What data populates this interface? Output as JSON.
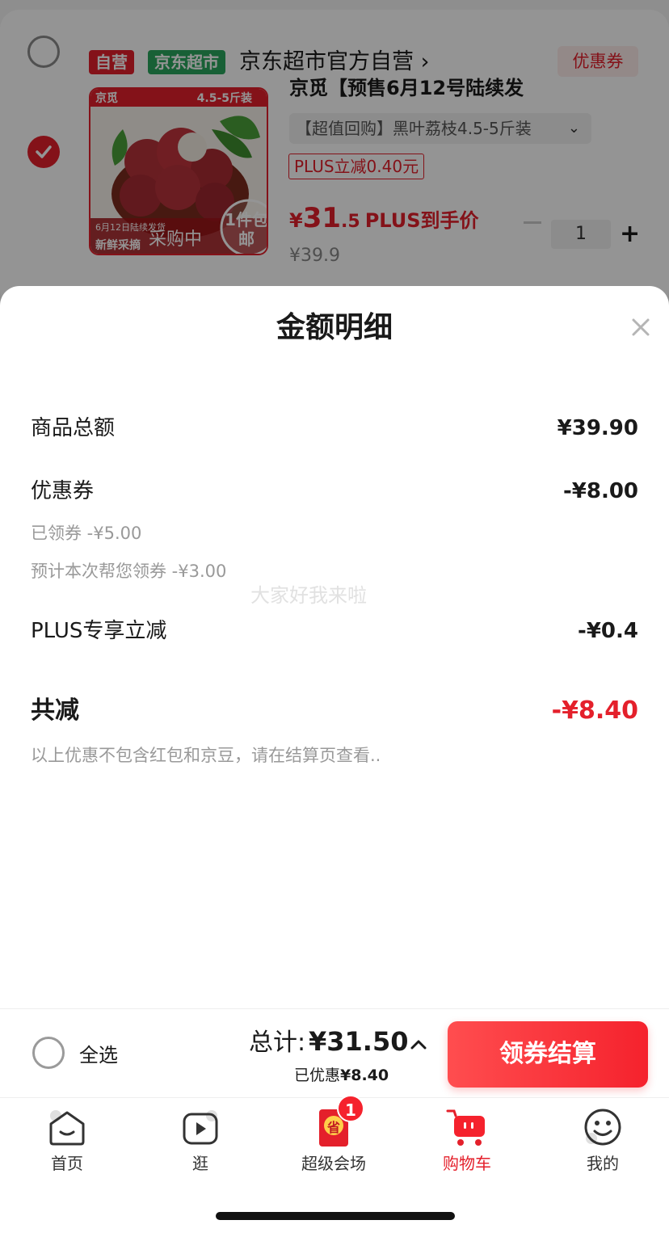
{
  "cart": {
    "shop_tag_self": "自营",
    "shop_tag_market": "京东超市",
    "shop_name": "京东超市官方自营 ›",
    "coupon_label": "优惠券",
    "product": {
      "title": "京觅【预售6月12号陆续发",
      "image_tag": "4.5-5斤装",
      "image_logo": "京觅",
      "image_badge_date": "6月12日陆续发货",
      "image_caption": "新鲜采摘",
      "image_overlay": "采购中",
      "image_free_ship": "1件包邮",
      "spec": "【超值回购】黑叶荔枝4.5-5斤装",
      "spec_chevron": "⌄",
      "plus_discount": "PLUS立减0.40元",
      "price_yen": "¥",
      "price_int": "31",
      "price_dec": ".5",
      "price_label": "PLUS到手价",
      "original_price": "¥39.9",
      "quantity": "1",
      "plus_sign": "+"
    }
  },
  "sheet": {
    "title": "金额明细",
    "rows": {
      "goods_total_label": "商品总额",
      "goods_total_value": "¥39.90",
      "coupon_label": "优惠券",
      "coupon_value": "-¥8.00",
      "claimed_coupon": "已领券 -¥5.00",
      "estimated_coupon": "预计本次帮您领券 -¥3.00",
      "plus_label": "PLUS专享立减",
      "plus_value": "-¥0.4",
      "total_discount_label": "共减",
      "total_discount_value": "-¥8.40"
    },
    "note": "以上优惠不包含红包和京豆，请在结算页查看..",
    "watermark": "大家好我来啦"
  },
  "checkout": {
    "select_all": "全选",
    "sum_prefix": "总计:",
    "sum_value": "¥31.50",
    "saved_prefix": "已优惠",
    "saved_value": "¥8.40",
    "button": "领券结算"
  },
  "tabs": [
    {
      "label": "首页",
      "icon": "home-icon"
    },
    {
      "label": "逛",
      "icon": "play-icon"
    },
    {
      "label": "超级会场",
      "icon": "red-envelope-icon",
      "badge": "1",
      "icon_text": "省"
    },
    {
      "label": "购物车",
      "icon": "cart-icon"
    },
    {
      "label": "我的",
      "icon": "smiley-icon"
    }
  ],
  "colors": {
    "accent": "#e4202b",
    "market_green": "#2aa65d"
  }
}
